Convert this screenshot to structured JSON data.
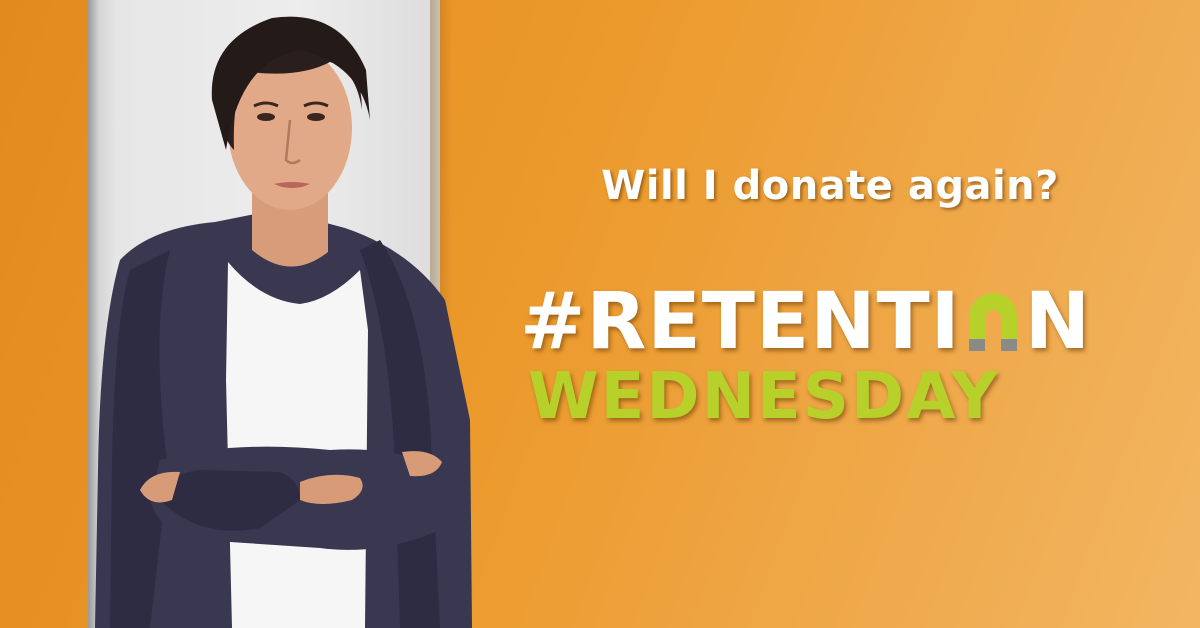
{
  "banner": {
    "tagline": "Will I donate again?",
    "headline_part_1": "#RETENTI",
    "headline_part_2": "N",
    "headline_line_2": "WEDNESDAY"
  },
  "colors": {
    "background_orange": "#ec9a2c",
    "headline_white": "#ffffff",
    "headline_green": "#b7d12a",
    "magnet_gray": "#8a8a8a"
  },
  "icons": {
    "magnet": "magnet-icon"
  }
}
